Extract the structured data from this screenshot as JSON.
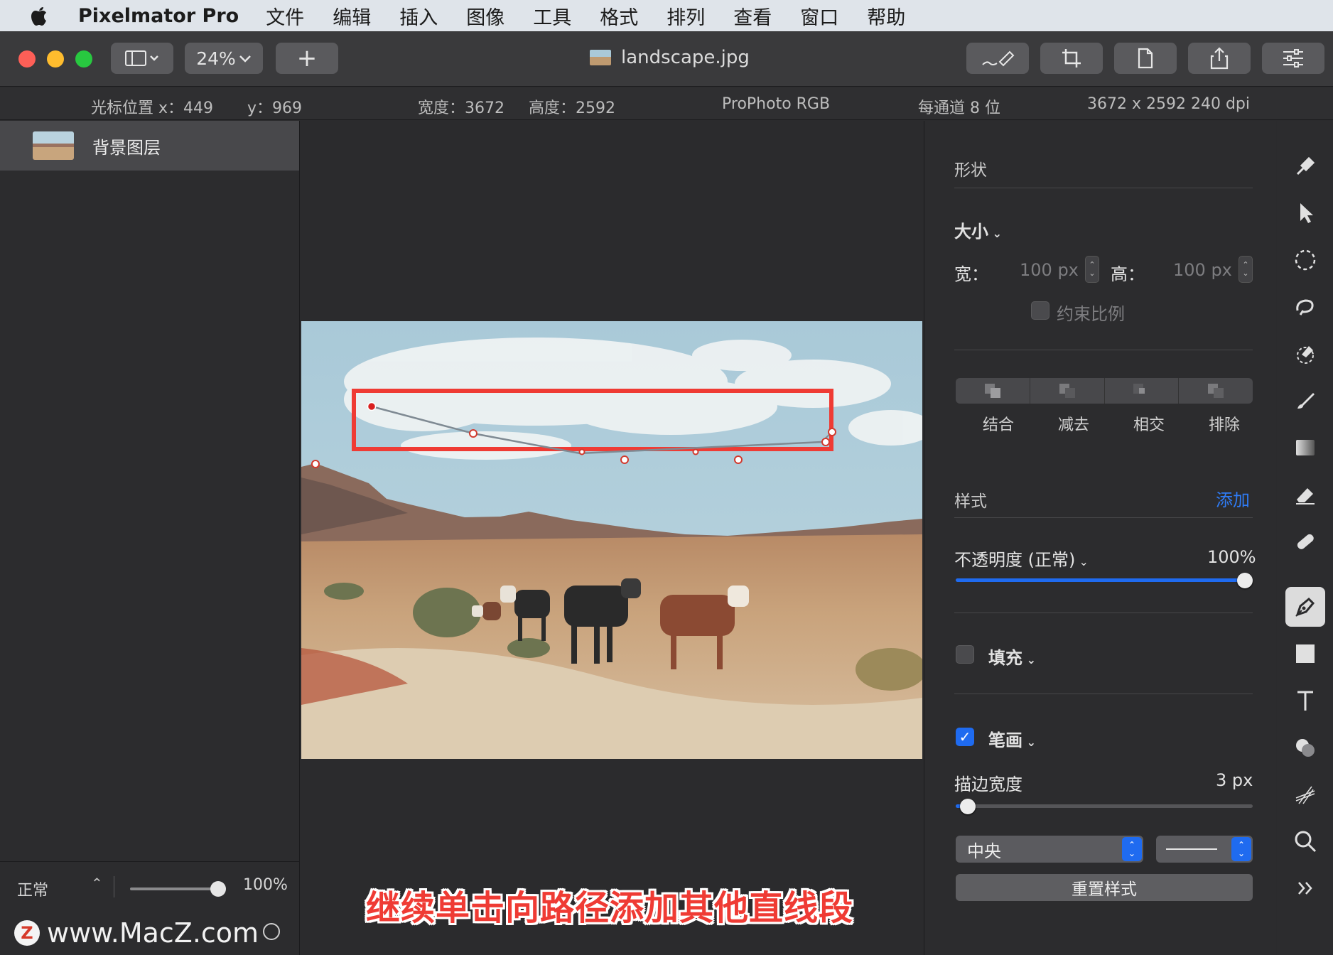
{
  "menubar": {
    "app_name": "Pixelmator Pro",
    "items": [
      "文件",
      "编辑",
      "插入",
      "图像",
      "工具",
      "格式",
      "排列",
      "查看",
      "窗口",
      "帮助"
    ]
  },
  "toolbar": {
    "zoom": "24%",
    "add_label": "+",
    "document_title": "landscape.jpg"
  },
  "infobar": {
    "cursor_x": "光标位置 x：449",
    "cursor_y": "y：969",
    "width": "宽度：3672",
    "height": "高度：2592",
    "color_profile": "ProPhoto RGB",
    "bit_depth": "每通道 8 位",
    "resolution": "3672 x 2592 240 dpi"
  },
  "layers": {
    "items": [
      {
        "name": "背景图层"
      }
    ],
    "blend_mode": "正常",
    "opacity": "100%",
    "opacity_value": 1.0
  },
  "watermark": {
    "logo": "Z",
    "text": "www.MacZ.com"
  },
  "canvas": {
    "caption": "继续单击向路径添加其他直线段"
  },
  "inspector": {
    "shape_header": "形状",
    "size_label": "大小",
    "width_label": "宽：",
    "width_value": "100 px",
    "height_label": "高：",
    "height_value": "100 px",
    "constrain_label": "约束比例",
    "constrain_checked": false,
    "boolean_ops": [
      "结合",
      "减去",
      "相交",
      "排除"
    ],
    "style_header": "样式",
    "add_label": "添加",
    "opacity_label": "不透明度 (正常)",
    "opacity_value": "100%",
    "opacity_fraction": 1.0,
    "fill_label": "填充",
    "fill_checked": false,
    "stroke_label": "笔画",
    "stroke_checked": true,
    "stroke_width_label": "描边宽度",
    "stroke_width_value": "3 px",
    "stroke_width_fraction": 0.04,
    "stroke_position": "中央",
    "reset_label": "重置样式"
  },
  "colors": {
    "accent": "#1f6bf0",
    "highlight_box": "#ef3b34",
    "caption": "#ef3b34"
  }
}
